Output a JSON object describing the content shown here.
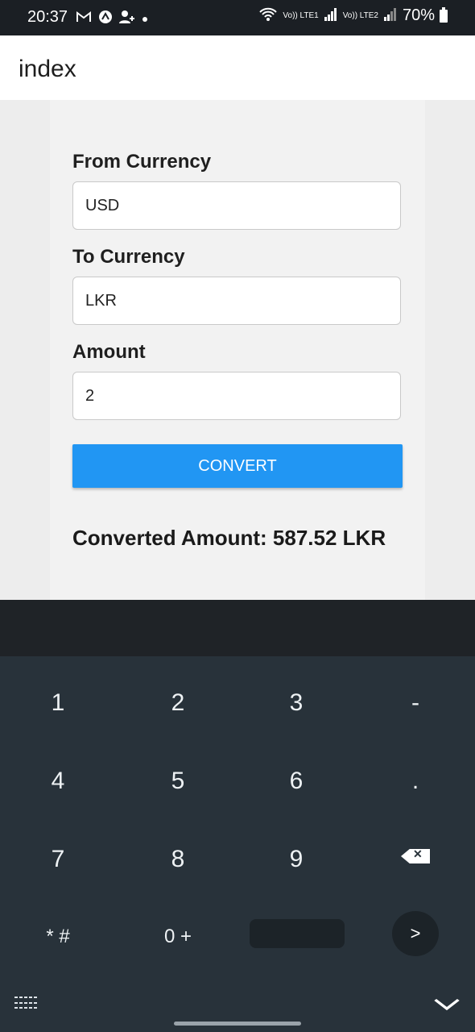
{
  "status_bar": {
    "time": "20:37",
    "left_icons": [
      "gmail-icon",
      "app-notification-icon",
      "person-add-icon",
      "dot-icon"
    ],
    "signal_labels": [
      "Vo)) LTE1",
      "Vo)) LTE2"
    ],
    "battery": "70%"
  },
  "app_bar": {
    "title": "index"
  },
  "form": {
    "from_label": "From Currency",
    "from_value": "USD",
    "to_label": "To Currency",
    "to_value": "LKR",
    "amount_label": "Amount",
    "amount_value": "2",
    "convert_label": "CONVERT",
    "result_text": "Converted Amount: 587.52 LKR"
  },
  "keyboard": {
    "keys": [
      "1",
      "2",
      "3",
      "-",
      "4",
      "5",
      "6",
      ".",
      "7",
      "8",
      "9",
      "⌫",
      "* #",
      "0 +",
      " ",
      ">"
    ],
    "accent_color": "#2196f3"
  }
}
